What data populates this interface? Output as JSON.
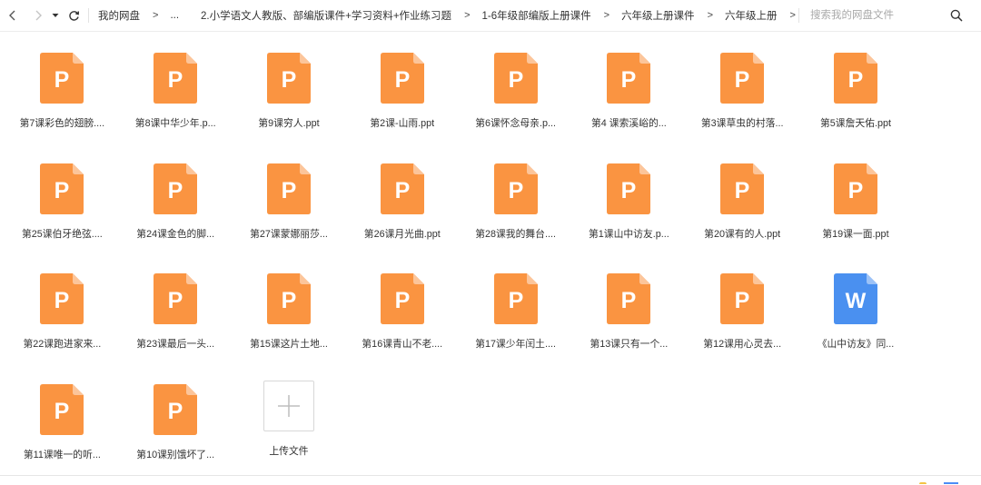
{
  "toolbar": {
    "back_icon": "chevron-left-icon",
    "forward_icon": "chevron-right-icon",
    "history_icon": "caret-down-icon",
    "refresh_icon": "refresh-icon",
    "breadcrumb": [
      "我的网盘",
      "...",
      "2.小学语文人教版、部编版课件+学习资料+作业练习题",
      "1-6年级部编版上册课件",
      "六年级上册课件",
      "六年级上册"
    ],
    "breadcrumb_separator": ">",
    "search": {
      "placeholder": "搜索我的网盘文件",
      "value": "",
      "icon": "search-icon"
    }
  },
  "files": [
    {
      "name": "第7课彩色的翅膀....",
      "type": "ppt"
    },
    {
      "name": "第8课中华少年.p...",
      "type": "ppt"
    },
    {
      "name": "第9课穷人.ppt",
      "type": "ppt"
    },
    {
      "name": "第2课-山雨.ppt",
      "type": "ppt"
    },
    {
      "name": "第6课怀念母亲.p...",
      "type": "ppt"
    },
    {
      "name": "第4 课索溪峪的...",
      "type": "ppt"
    },
    {
      "name": "第3课草虫的村落...",
      "type": "ppt"
    },
    {
      "name": "第5课詹天佑.ppt",
      "type": "ppt"
    },
    {
      "name": "第25课伯牙绝弦....",
      "type": "ppt"
    },
    {
      "name": "第24课金色的脚...",
      "type": "ppt"
    },
    {
      "name": "第27课蒙娜丽莎...",
      "type": "ppt"
    },
    {
      "name": "第26课月光曲.ppt",
      "type": "ppt"
    },
    {
      "name": "第28课我的舞台....",
      "type": "ppt"
    },
    {
      "name": "第1课山中访友.p...",
      "type": "ppt"
    },
    {
      "name": "第20课有的人.ppt",
      "type": "ppt"
    },
    {
      "name": "第19课一面.ppt",
      "type": "ppt"
    },
    {
      "name": "第22课跑进家来...",
      "type": "ppt"
    },
    {
      "name": "第23课最后一头...",
      "type": "ppt"
    },
    {
      "name": "第15课这片土地...",
      "type": "ppt"
    },
    {
      "name": "第16课青山不老....",
      "type": "ppt"
    },
    {
      "name": "第17课少年闰土....",
      "type": "ppt"
    },
    {
      "name": "第13课只有一个...",
      "type": "ppt"
    },
    {
      "name": "第12课用心灵去...",
      "type": "ppt"
    },
    {
      "name": "《山中访友》同...",
      "type": "doc"
    },
    {
      "name": "第11课唯一的听...",
      "type": "ppt"
    },
    {
      "name": "第10课别饿坏了...",
      "type": "ppt"
    }
  ],
  "file_icons": {
    "ppt": {
      "letter": "P",
      "color": "#FA9441",
      "fold": "#FCC59A",
      "icon": "ppt-file-icon"
    },
    "doc": {
      "letter": "W",
      "color": "#4A90F0",
      "fold": "#9CC2F7",
      "icon": "word-file-icon"
    }
  },
  "upload": {
    "label": "上传文件",
    "icon": "plus-icon"
  }
}
